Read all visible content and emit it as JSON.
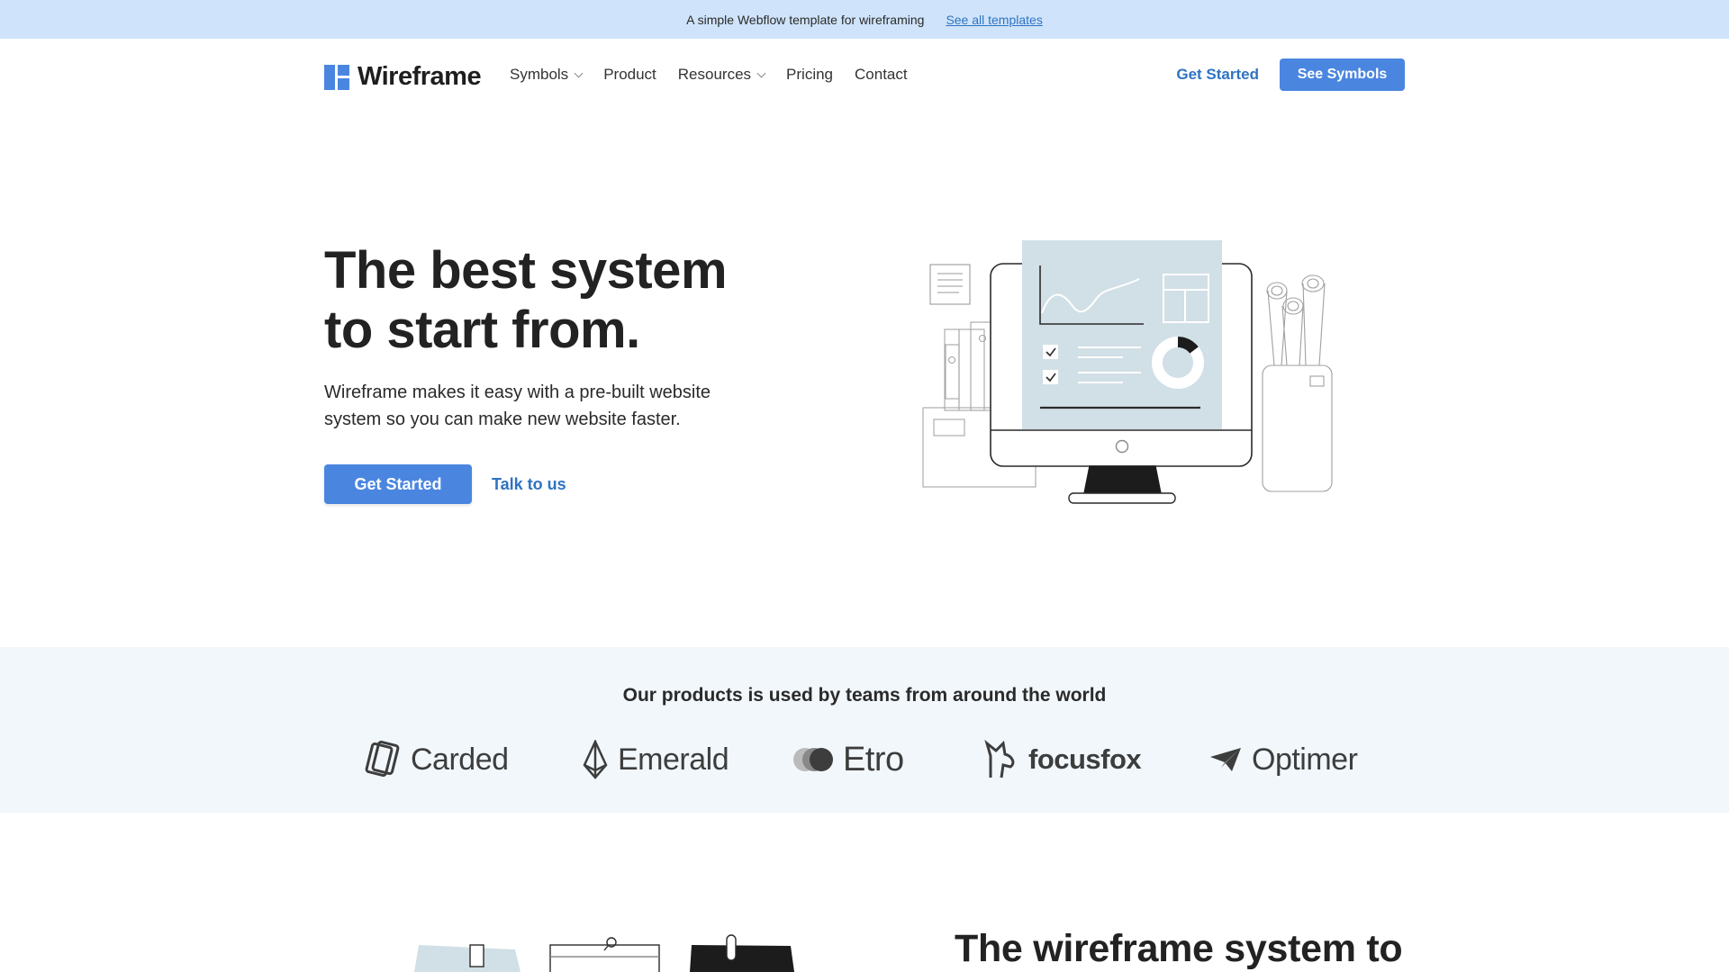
{
  "announcement": {
    "text": "A simple Webflow template for wireframing",
    "link": "See all templates"
  },
  "nav": {
    "brand": "Wireframe",
    "items": [
      {
        "label": "Symbols",
        "dropdown": true
      },
      {
        "label": "Product",
        "dropdown": false
      },
      {
        "label": "Resources",
        "dropdown": true
      },
      {
        "label": "Pricing",
        "dropdown": false
      },
      {
        "label": "Contact",
        "dropdown": false
      }
    ],
    "get_started": "Get Started",
    "see_symbols": "See Symbols"
  },
  "hero": {
    "title_line1": "The best system",
    "title_line2": "to start from.",
    "description": "Wireframe makes it easy with a pre-built website system so you can make new website faster.",
    "primary_cta": "Get Started",
    "secondary_cta": "Talk to us"
  },
  "trust": {
    "title": "Our products is used by teams from around the world",
    "logos": [
      "Carded",
      "Emerald",
      "Etro",
      "focusfox",
      "Optimer"
    ]
  },
  "section2": {
    "title": "The wireframe system to"
  },
  "colors": {
    "accent": "#4a86e0",
    "link": "#2f73c2",
    "announce_bg": "#cfe4fa",
    "band_bg": "#f1f7fb",
    "screen_fill": "#d1dfe6"
  }
}
